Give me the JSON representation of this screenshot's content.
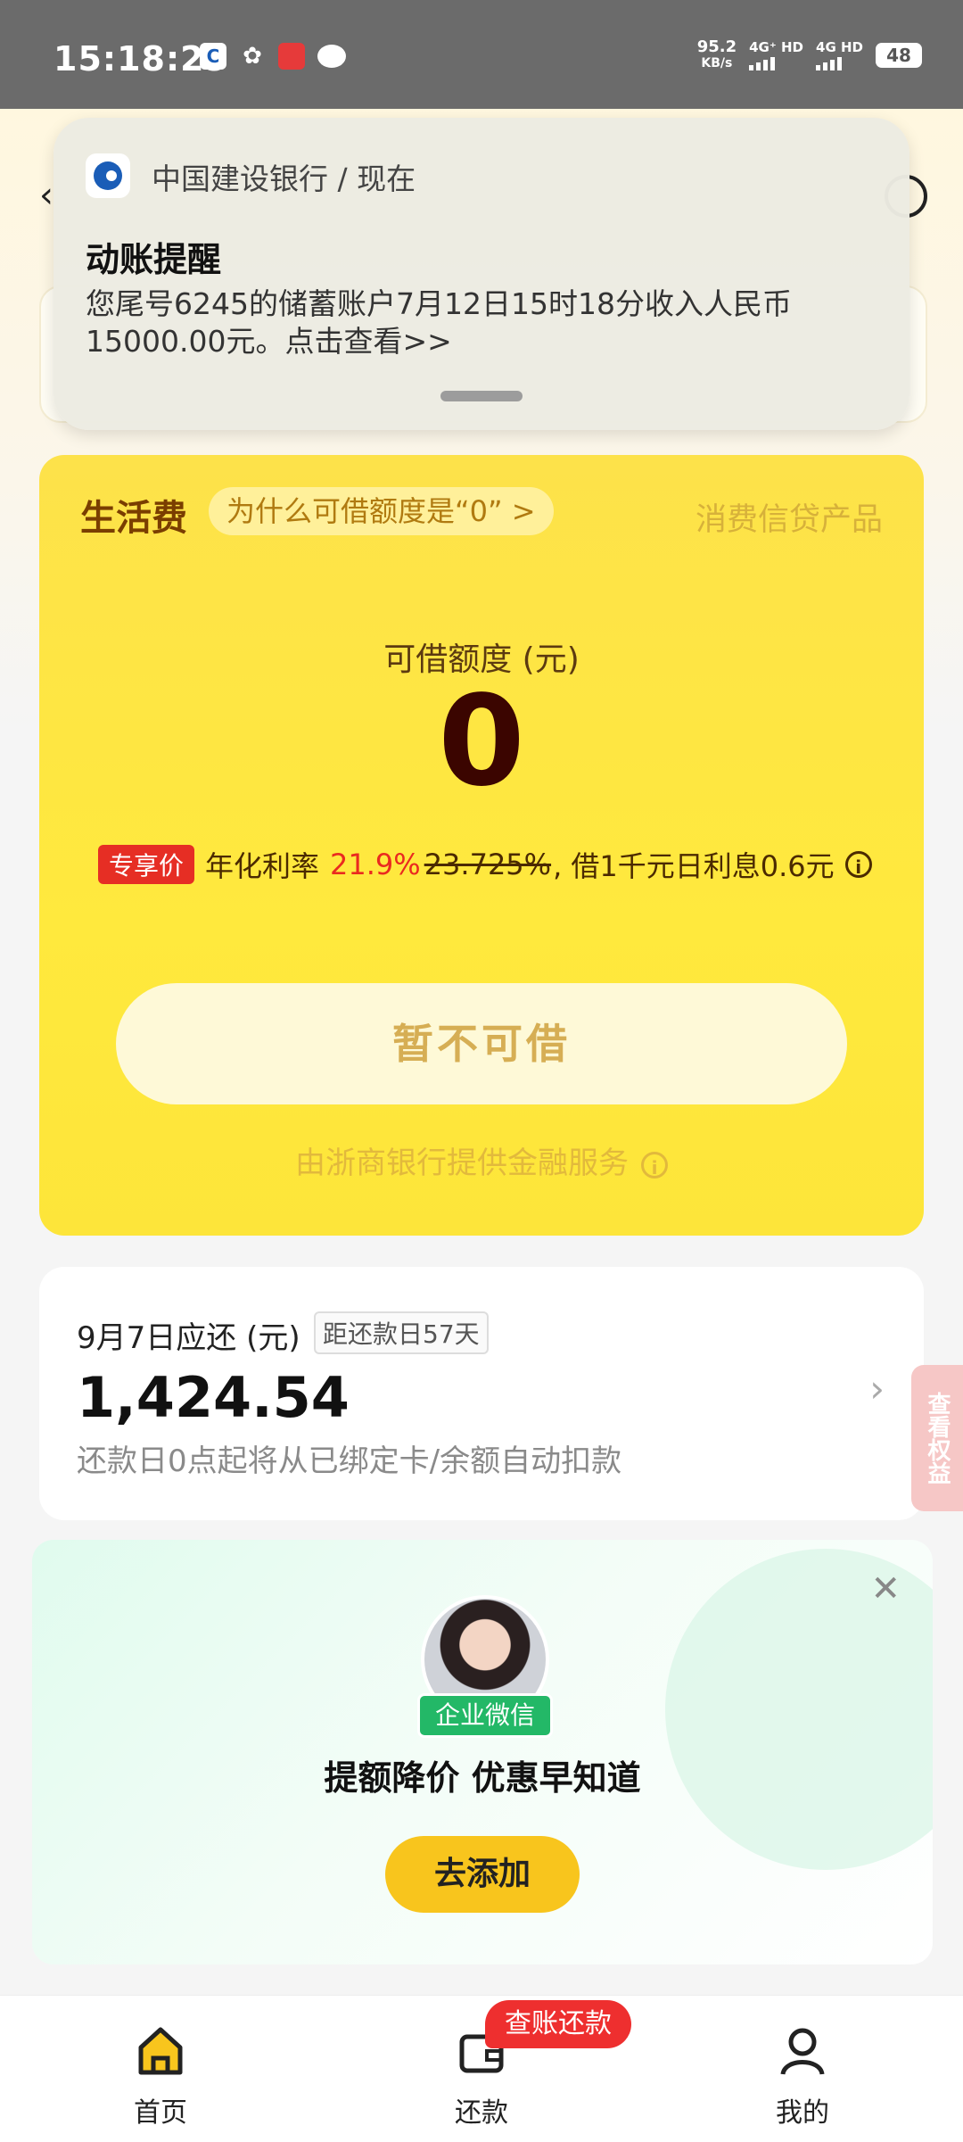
{
  "status_bar": {
    "time": "15:18:29",
    "net_speed_value": "95.2",
    "net_speed_unit": "KB/s",
    "sim1": "4G⁺ HD",
    "sim2": "4G HD",
    "battery": "48",
    "icons": [
      "ccb-app-icon",
      "wechat-icon",
      "red-app-icon",
      "message-icon"
    ]
  },
  "notification": {
    "source": "中国建设银行 / 现在",
    "title": "动账提醒",
    "body": "您尾号6245的储蓄账户7月12日15时18分收入人民币15000.00元。点击查看>>"
  },
  "credit": {
    "title": "生活费",
    "why_label": "为什么可借额度是“0” >",
    "product_label": "消费信贷产品",
    "limit_label": "可借额度 (元)",
    "limit_value": "0",
    "badge": "专享价",
    "rate_prefix": "年化利率",
    "rate_current": "21.9%",
    "rate_original": "23.725%",
    "rate_suffix": ", 借1千元日利息0.6元",
    "button_label": "暂不可借",
    "provider": "由浙商银行提供金融服务"
  },
  "repayment": {
    "title": "9月7日应还 (元)",
    "tag": "距还款日57天",
    "amount": "1,424.54",
    "note": "还款日0点起将从已绑定卡/余额自动扣款"
  },
  "side_tab": "查看权益",
  "wecom": {
    "badge": "企业微信",
    "title": "提额降价 优惠早知道",
    "button": "去添加"
  },
  "bottom_nav": {
    "items": [
      {
        "label": "首页",
        "icon": "home-icon",
        "active": true
      },
      {
        "label": "还款",
        "icon": "wallet-icon",
        "active": false
      },
      {
        "label": "我的",
        "icon": "user-icon",
        "active": false
      }
    ],
    "badge": "查账还款"
  },
  "colors": {
    "accent_yellow": "#ffe93d",
    "button_yellow": "#f8c51d",
    "rate_red": "#ea2a1f",
    "wecom_green": "#23b867"
  }
}
